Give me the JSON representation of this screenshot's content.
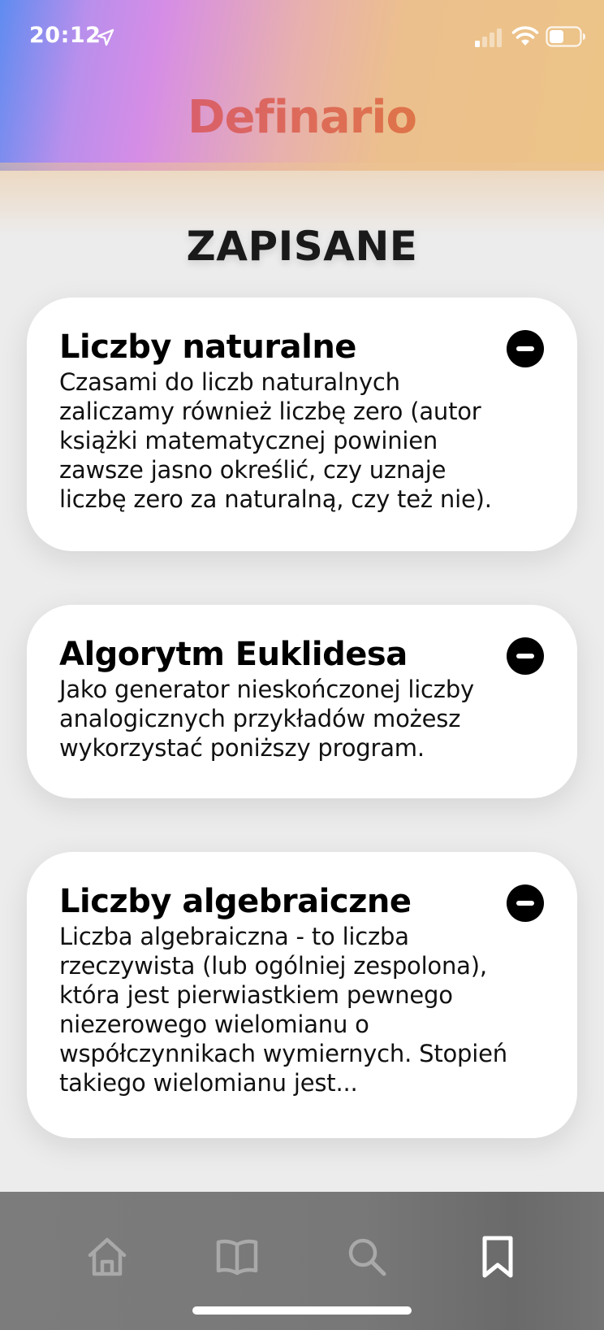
{
  "status_bar": {
    "time": "20:12",
    "icons": [
      "location-arrow-icon",
      "cellular-signal-icon",
      "wifi-icon",
      "battery-icon"
    ]
  },
  "header": {
    "app_title": "Definario",
    "gradient_colors": [
      "#5f8cf0",
      "#d58de6",
      "#ecc488"
    ],
    "title_gradient": [
      "#d14f86",
      "#e0862e"
    ]
  },
  "page": {
    "section_title": "ZAPISANE"
  },
  "saved_items": [
    {
      "title": "Liczby naturalne",
      "text": "Czasami do liczb naturalnych zaliczamy również liczbę zero (autor książki matematycznej powinien zawsze jasno określić, czy uznaje liczbę zero za naturalną, czy też nie).",
      "remove_icon": "minus-circle-icon"
    },
    {
      "title": "Algorytm Euklidesa",
      "text": "Jako generator nieskończonej liczby analogicznych przykładów możesz wykorzystać poniższy program.",
      "remove_icon": "minus-circle-icon"
    },
    {
      "title": "Liczby algebraiczne",
      "text": "Liczba algebraiczna - to liczba rzeczywista (lub ogólniej zespolona), która jest pierwiastkiem pewnego niezerowego wielomianu o współczynnikach wymiernych. Stopień takiego wielomianu jest...",
      "remove_icon": "minus-circle-icon"
    }
  ],
  "tab_bar": {
    "tabs": [
      {
        "icon": "home-icon",
        "active": false
      },
      {
        "icon": "book-icon",
        "active": false
      },
      {
        "icon": "search-icon",
        "active": false
      },
      {
        "icon": "bookmark-icon",
        "active": true
      }
    ],
    "inactive_color": "#a9a9a9",
    "active_color": "#ffffff"
  }
}
